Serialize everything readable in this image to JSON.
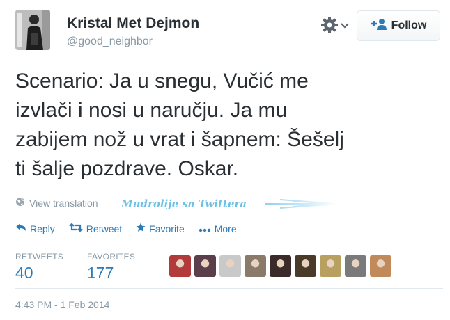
{
  "user": {
    "name": "Kristal Met Dejmon",
    "handle": "@good_neighbor"
  },
  "follow_button": {
    "label": "Follow"
  },
  "tweet": {
    "lines": [
      "Scenario: Ja u snegu, Vučić me",
      "izvlači i nosi u naručju. Ja mu",
      "zabijem nož u vrat i šapnem: Šešelj",
      "ti šalje pozdrave. Oskar."
    ],
    "translation_link": "View translation",
    "watermark": "Mudrolije sa Twittera"
  },
  "actions": {
    "reply": "Reply",
    "retweet": "Retweet",
    "favorite": "Favorite",
    "more": "More"
  },
  "stats": {
    "retweets_label": "RETWEETS",
    "retweets_value": "40",
    "favorites_label": "FAVORITES",
    "favorites_value": "177"
  },
  "favoriters": [
    {
      "color": "#b23a3a"
    },
    {
      "color": "#5a3e4a"
    },
    {
      "color": "#c9c9c9"
    },
    {
      "color": "#8a7a6a"
    },
    {
      "color": "#3b2a2a"
    },
    {
      "color": "#4a3a2a"
    },
    {
      "color": "#b8a060"
    },
    {
      "color": "#7a7a7a"
    },
    {
      "color": "#c08a5a"
    }
  ],
  "timestamp": "4:43 PM - 1 Feb 2014",
  "colors": {
    "link": "#2b7bb9",
    "muted": "#8899a6",
    "text": "#292f33",
    "border": "#e1e8ed"
  }
}
